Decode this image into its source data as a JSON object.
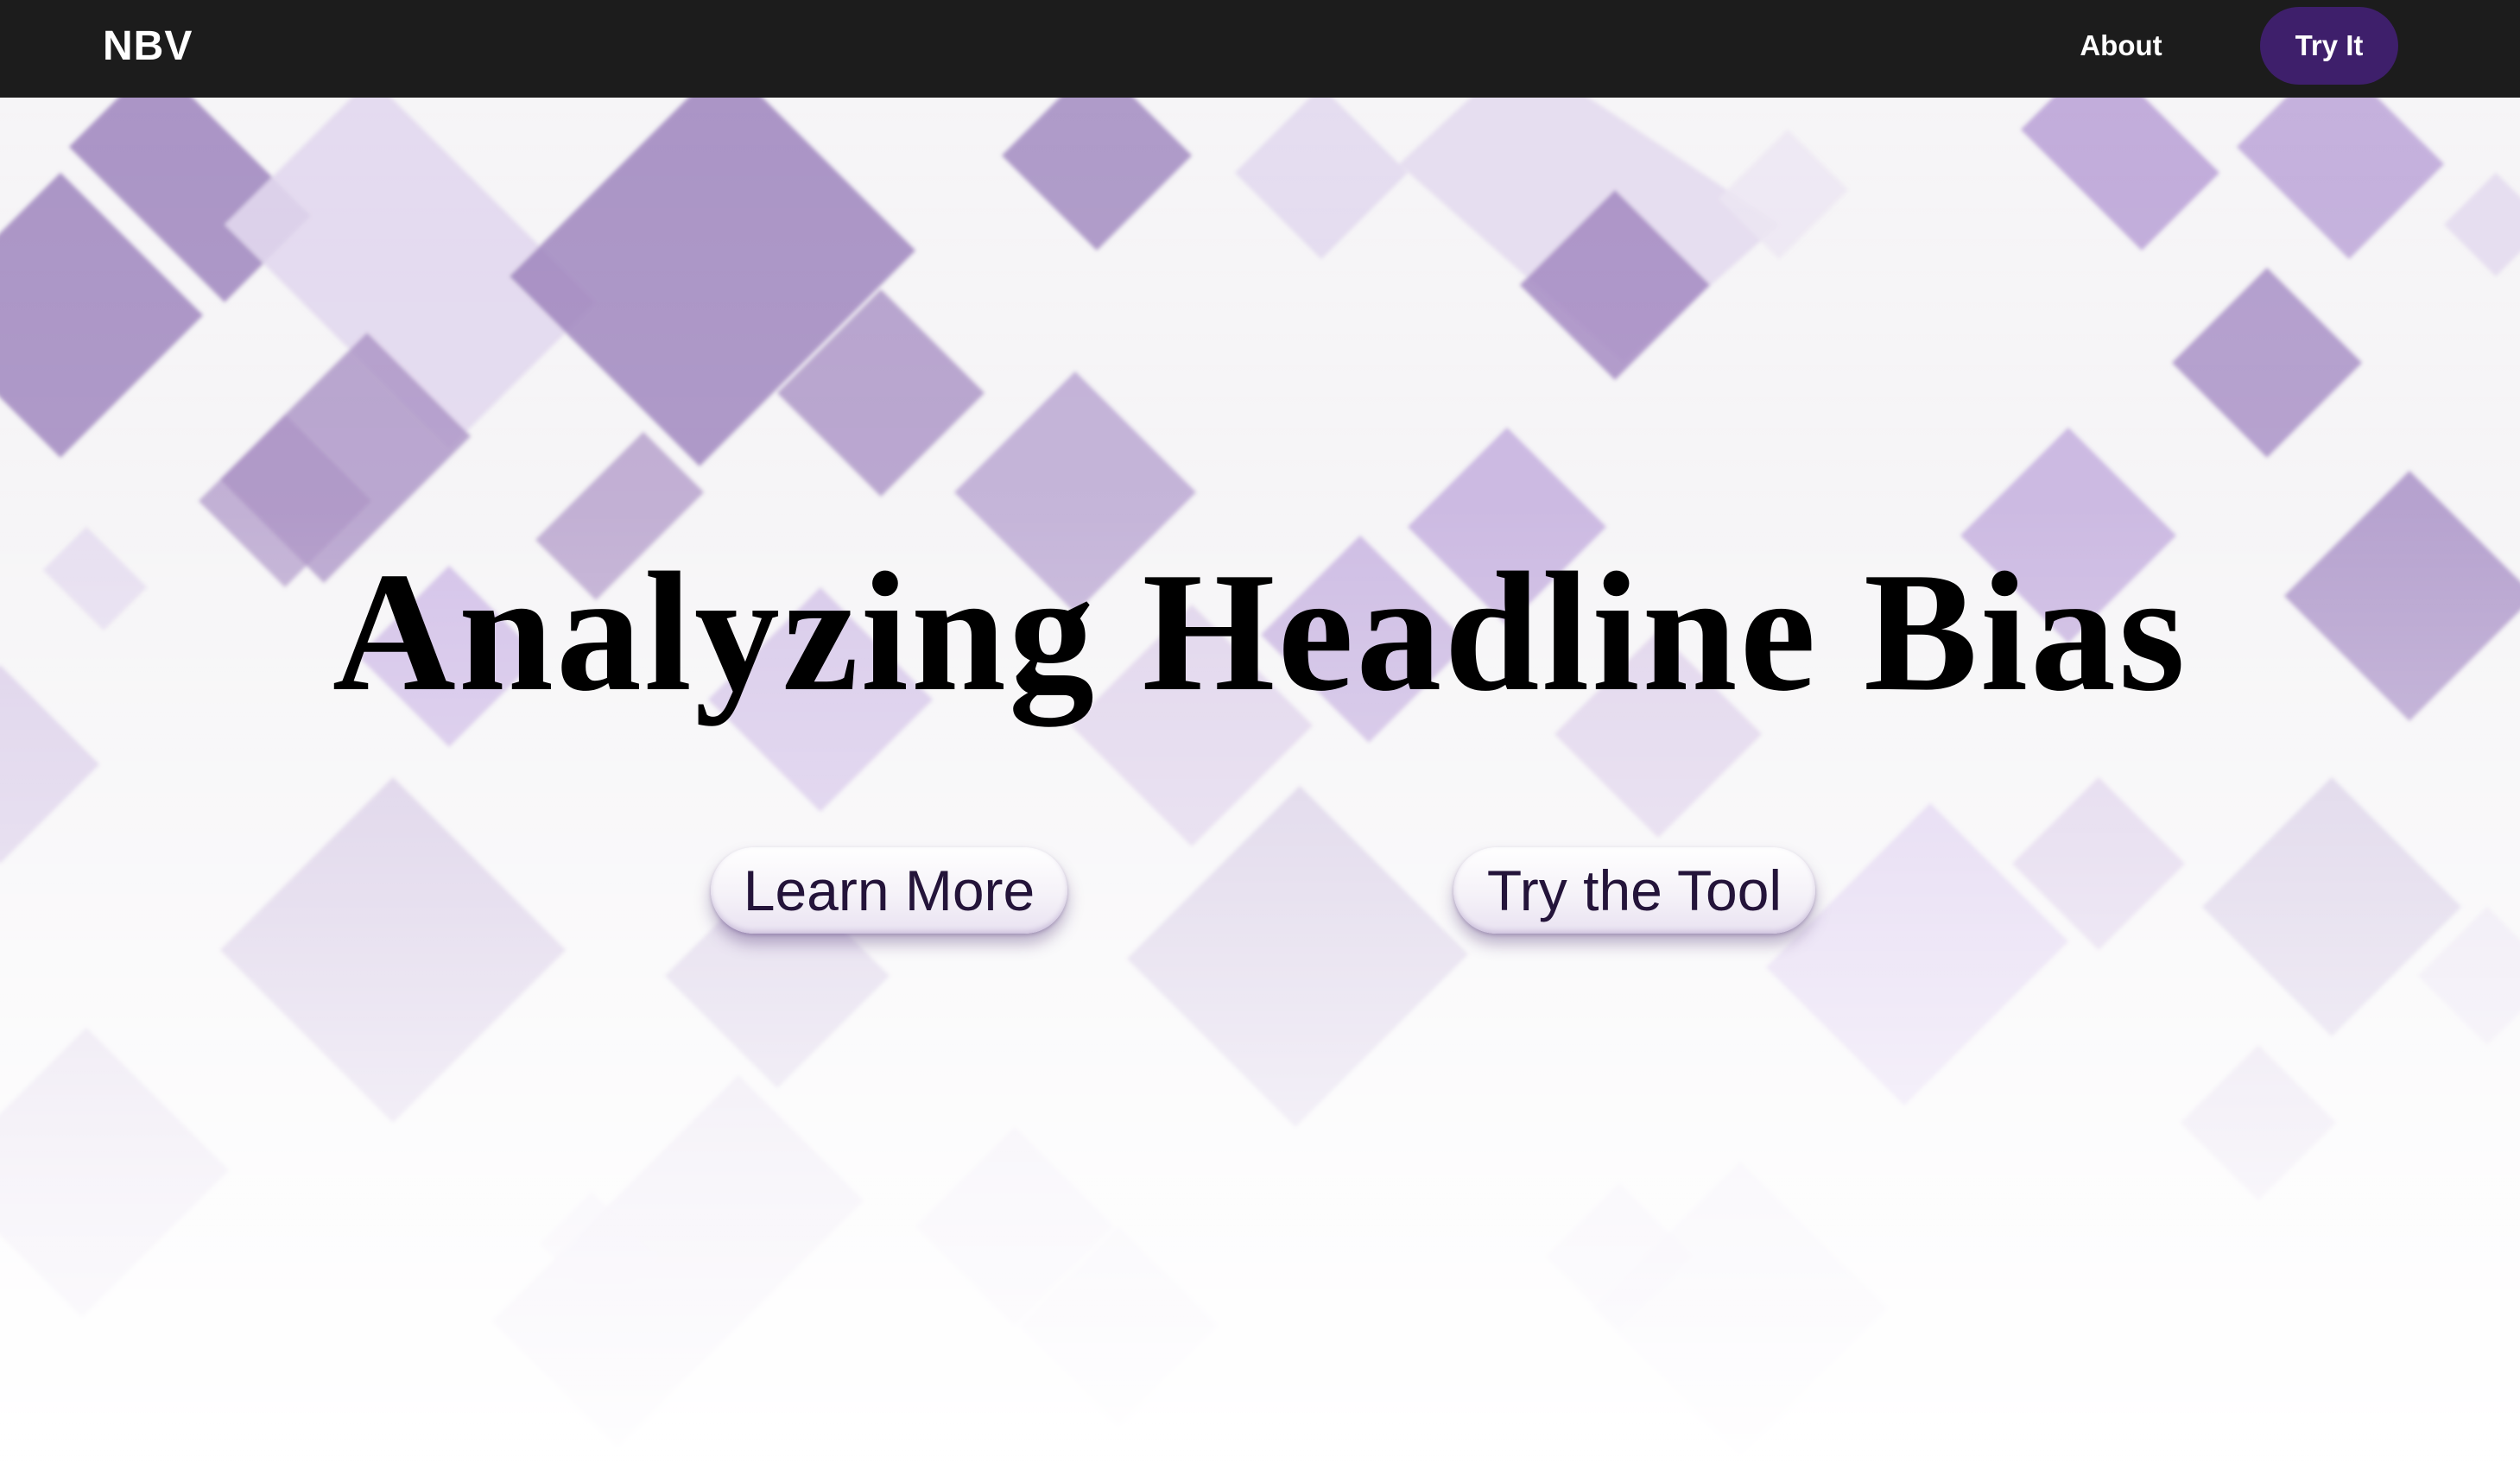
{
  "navbar": {
    "brand": "NBV",
    "about_label": "About",
    "try_label": "Try It"
  },
  "hero": {
    "title": "Analyzing Headline Bias",
    "learn_more_label": "Learn More",
    "try_tool_label": "Try the Tool"
  },
  "colors": {
    "navbar_bg": "#1c1c1c",
    "accent": "#3e1f6b",
    "pattern_purple": "#a88fc3"
  }
}
